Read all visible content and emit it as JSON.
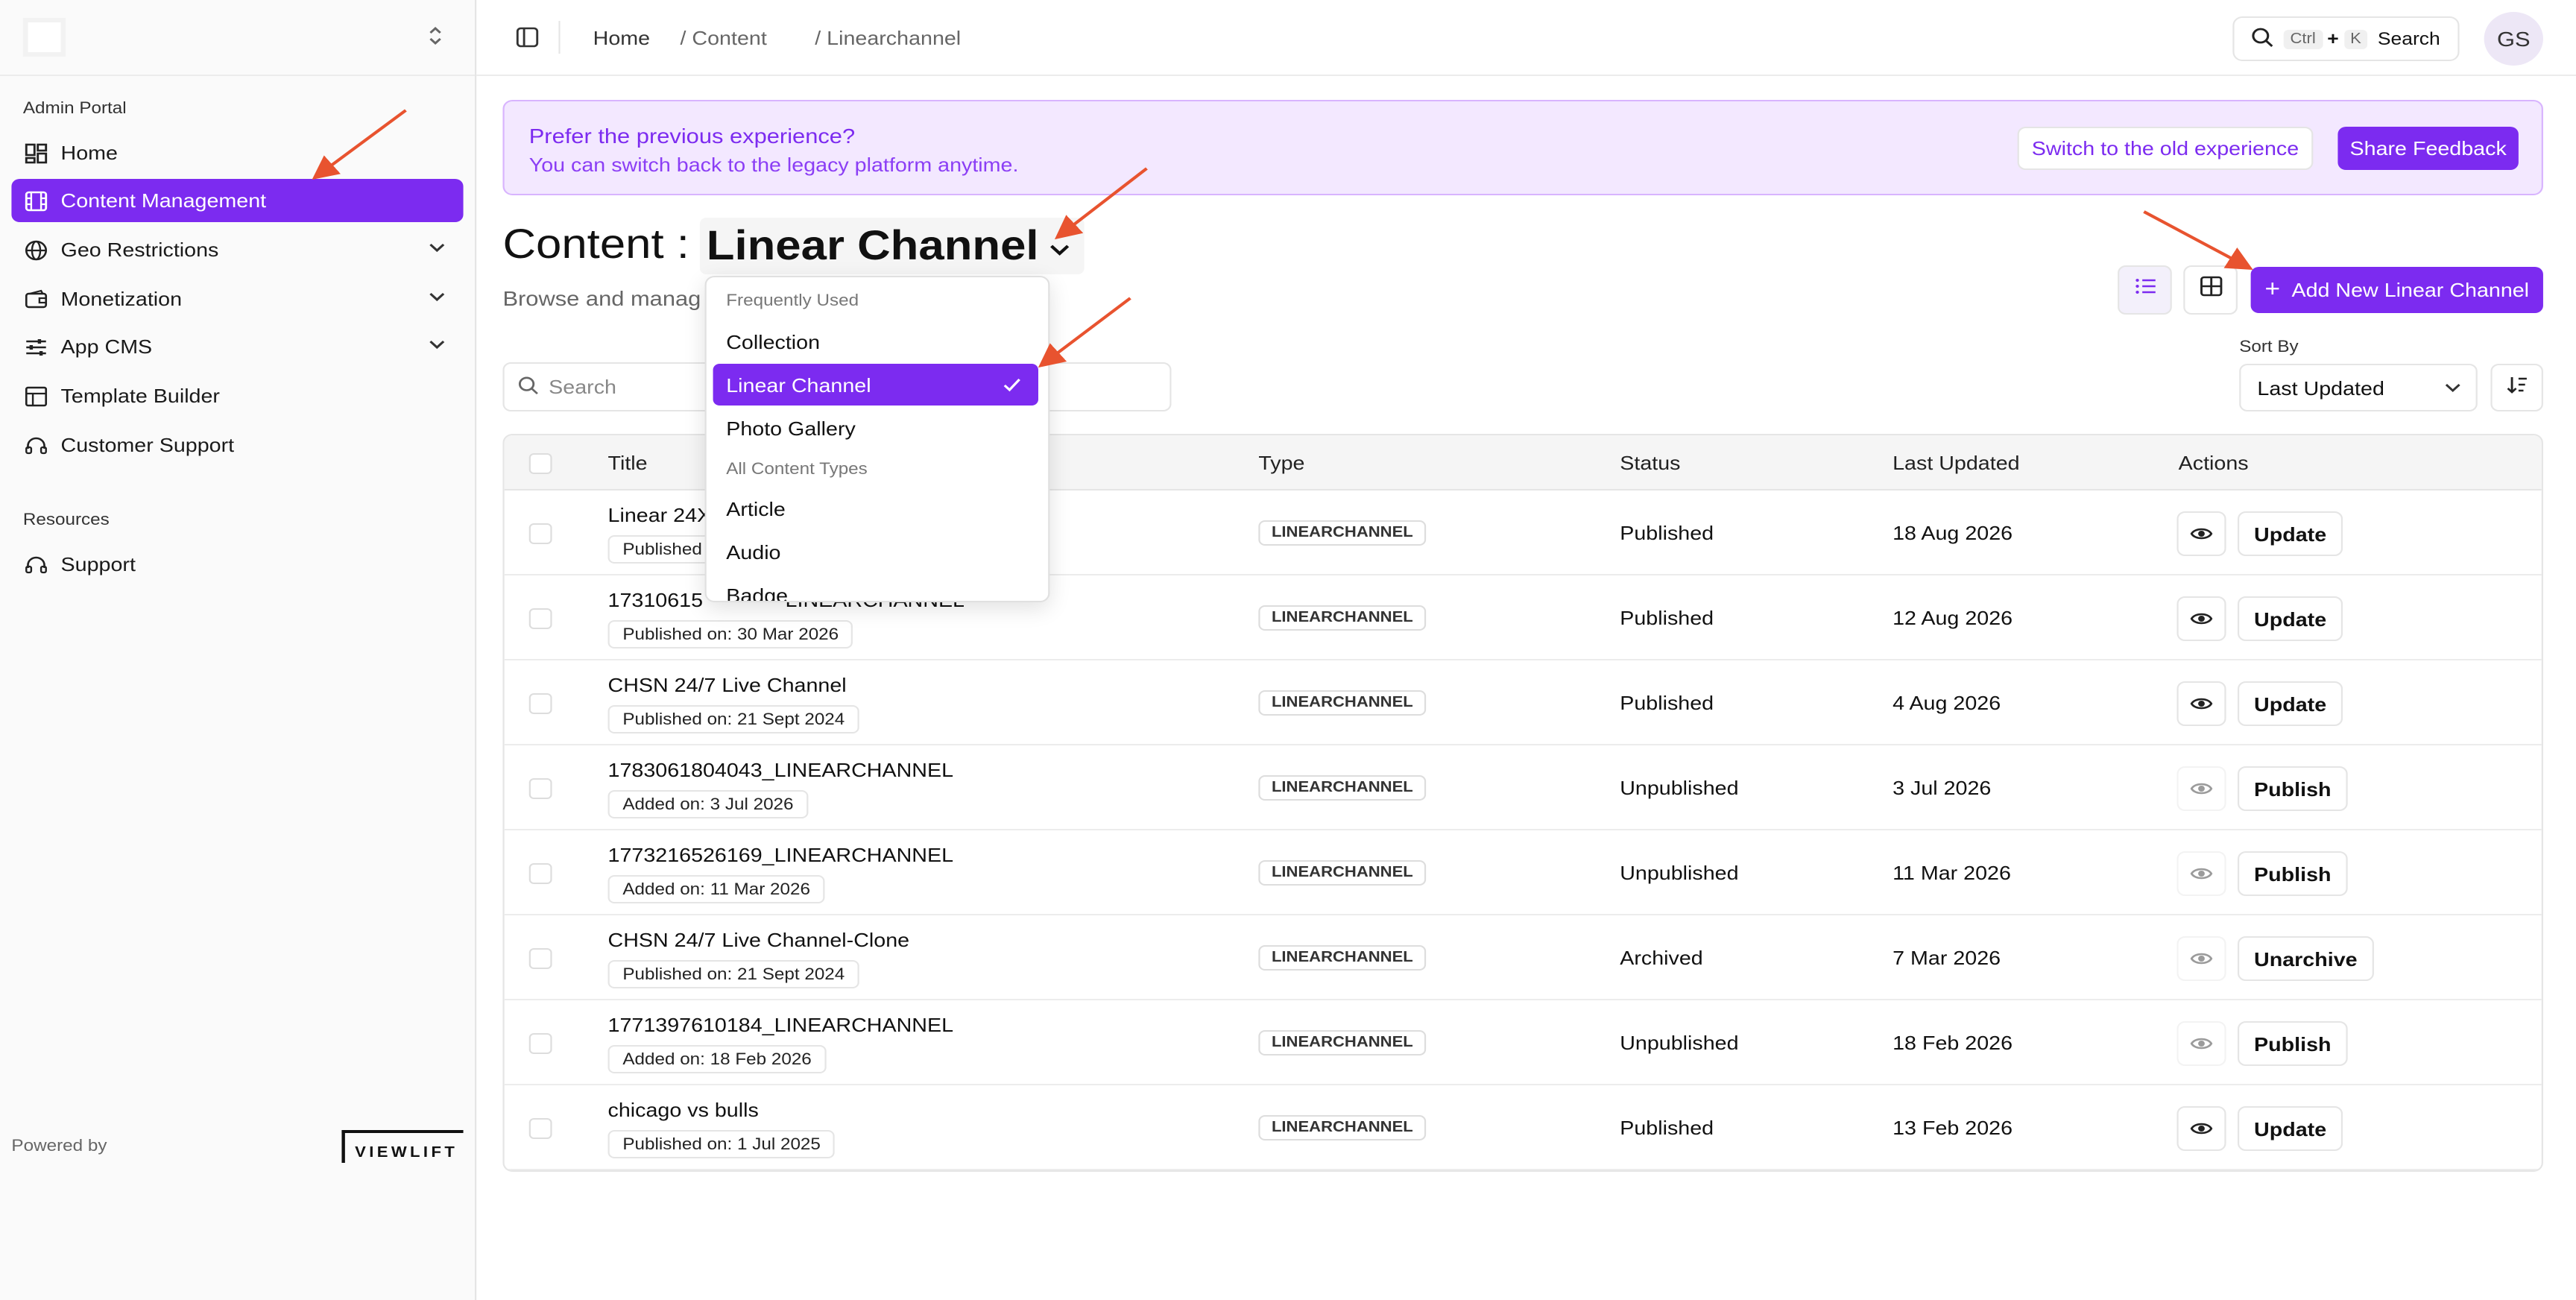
{
  "sidebar": {
    "section_admin": "Admin Portal",
    "items": [
      {
        "label": "Home"
      },
      {
        "label": "Content Management"
      },
      {
        "label": "Geo Restrictions"
      },
      {
        "label": "Monetization"
      },
      {
        "label": "App CMS"
      },
      {
        "label": "Template Builder"
      },
      {
        "label": "Customer Support"
      }
    ],
    "section_resources": "Resources",
    "resources": [
      {
        "label": "Support"
      }
    ],
    "powered_by": "Powered by",
    "brand_logo_text": "VIEWLIFT"
  },
  "topbar": {
    "breadcrumbs": [
      "Home",
      "/ Content",
      "/ Linearchannel"
    ],
    "search": {
      "kbd_ctrl": "Ctrl",
      "plus": "+",
      "kbd_k": "K",
      "label": "Search"
    },
    "avatar": "GS"
  },
  "banner": {
    "title": "Prefer the previous experience?",
    "subtitle": "You can switch back to the legacy platform anytime.",
    "switch_label": "Switch to the old experience",
    "feedback_label": "Share Feedback"
  },
  "heading": {
    "prefix": "Content :",
    "type": "Linear Channel",
    "subline": "Browse and manag"
  },
  "toolbar": {
    "add_label": "Add New Linear Channel",
    "sort_label": "Sort By",
    "sort_value": "Last Updated",
    "search_placeholder": "Search"
  },
  "dropdown": {
    "group1": "Frequently Used",
    "items1": [
      "Collection",
      "Linear Channel",
      "Photo Gallery"
    ],
    "selected": "Linear Channel",
    "group2": "All Content Types",
    "items2": [
      "Article",
      "Audio",
      "Badge"
    ]
  },
  "table": {
    "headers": [
      "Title",
      "Type",
      "Status",
      "Last Updated",
      "Actions"
    ],
    "rows": [
      {
        "title": "Linear 24X",
        "date": "Published",
        "type": "LINEARCHANNEL",
        "status": "Published",
        "updated": "18 Aug 2026",
        "action": "Update",
        "eye_active": true
      },
      {
        "title": "17310615",
        "title_tail": "LINEARCHANNEL",
        "date": "Published on: 30 Mar 2026",
        "type": "LINEARCHANNEL",
        "status": "Published",
        "updated": "12 Aug 2026",
        "action": "Update",
        "eye_active": true
      },
      {
        "title": "CHSN 24/7 Live Channel",
        "date": "Published on: 21 Sept 2024",
        "type": "LINEARCHANNEL",
        "status": "Published",
        "updated": "4 Aug 2026",
        "action": "Update",
        "eye_active": true
      },
      {
        "title": "1783061804043_LINEARCHANNEL",
        "date": "Added on: 3 Jul 2026",
        "type": "LINEARCHANNEL",
        "status": "Unpublished",
        "updated": "3 Jul 2026",
        "action": "Publish",
        "eye_active": false
      },
      {
        "title": "1773216526169_LINEARCHANNEL",
        "date": "Added on: 11 Mar 2026",
        "type": "LINEARCHANNEL",
        "status": "Unpublished",
        "updated": "11 Mar 2026",
        "action": "Publish",
        "eye_active": false
      },
      {
        "title": "CHSN 24/7 Live Channel-Clone",
        "date": "Published on: 21 Sept 2024",
        "type": "LINEARCHANNEL",
        "status": "Archived",
        "updated": "7 Mar 2026",
        "action": "Unarchive",
        "eye_active": false
      },
      {
        "title": "1771397610184_LINEARCHANNEL",
        "date": "Added on: 18 Feb 2026",
        "type": "LINEARCHANNEL",
        "status": "Unpublished",
        "updated": "18 Feb 2026",
        "action": "Publish",
        "eye_active": false
      },
      {
        "title": "chicago vs bulls",
        "date": "Published on: 1 Jul 2025",
        "type": "LINEARCHANNEL",
        "status": "Published",
        "updated": "13 Feb 2026",
        "action": "Update",
        "eye_active": true
      }
    ]
  },
  "colors": {
    "accent": "#7c2bf0",
    "banner_bg": "#f3e8ff",
    "annotation_arrow": "#e8532f"
  }
}
